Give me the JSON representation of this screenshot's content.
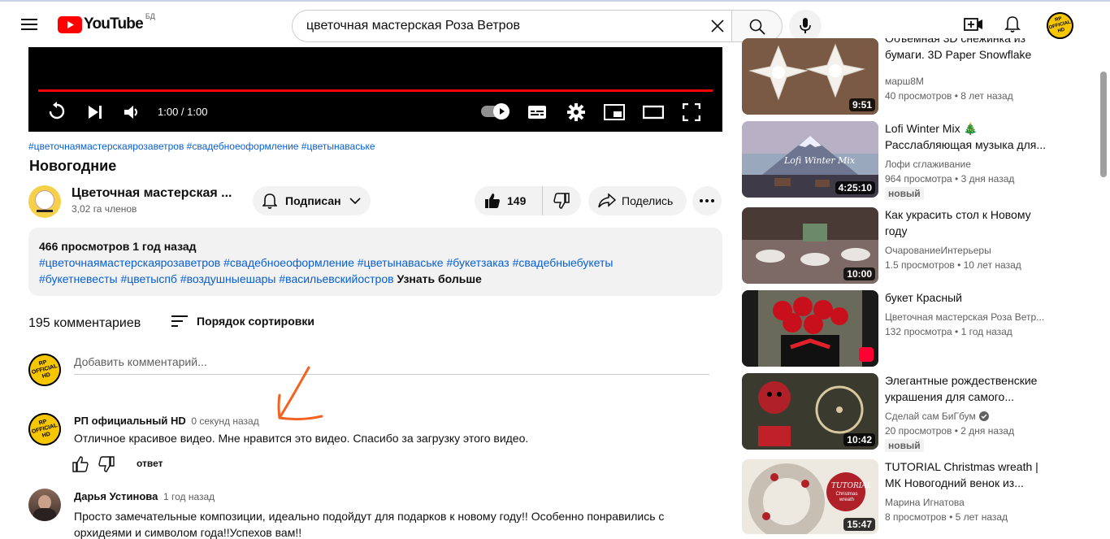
{
  "header": {
    "logo_text": "YouTube",
    "region": "БД",
    "search_value": "цветочная мастерская Роза Ветров",
    "avatar_text": "RP OFFICIAL HD"
  },
  "player": {
    "time": "1:00 / 1:00",
    "progress_percent": 100
  },
  "video": {
    "hashtags": "#цветочнаямастерскаярозаветров #свадебноеоформление #цветынаваське",
    "title": "Новогодние",
    "channel_name": "Цветочная мастерская ...",
    "channel_subs": "3,02 га членов",
    "subscribe_label": "Подписан",
    "likes": "149",
    "share_label": "Поделись"
  },
  "description": {
    "stats": "466 просмотров  1 год назад",
    "tags_line1": "#цветочнаямастерскаярозаветров #свадебноеоформление #цветынаваське #букетзаказ #свадебныебукеты",
    "tags_line2": "#букетневесты #цветыспб #воздушныешары #васильевскийостров",
    "more": "Узнать больше"
  },
  "comments": {
    "count": "195 комментариев",
    "sort_label": "Порядок сортировки",
    "add_placeholder": "Добавить комментарий...",
    "items": [
      {
        "author": "РП официальный HD",
        "time": "0 секунд назад",
        "text": "Отличное красивое видео. Мне нравится это видео. Спасибо за загрузку этого видео.",
        "reply": "ответ"
      },
      {
        "author": "Дарья Устинова",
        "time": "1 год назад",
        "text_line1": "Просто замечательные композиции, идеально подойдут для подарков к новому году!! Особенно понравились с",
        "text_line2": "орхидеями и символом года!!Успехов вам!!"
      }
    ]
  },
  "related": [
    {
      "title_line1": "Объемная 3D снежинка из",
      "title_line2": "бумаги. 3D Paper Snowflake",
      "channel": "марш8М",
      "meta": "40 просмотров • 8 лет назад",
      "duration": "9:51"
    },
    {
      "title_line1": "Lofi Winter Mix 🎄",
      "title_line2": "Расслабляющая музыка для...",
      "channel": "Лофи сглаживание",
      "meta": "964 просмотра • 3 дня назад",
      "duration": "4:25:10",
      "badge": "новый",
      "thumb_text": "Lofi Winter Mix"
    },
    {
      "title_line1": "Как украсить стол к Новому",
      "title_line2": "году",
      "channel": "ОчарованиеИнтерьеры",
      "meta": "1.5 просмотров • 10 лет назад",
      "duration": "10:00"
    },
    {
      "title_line1": "букет Красный",
      "channel": "Цветочная мастерская Роза Ветр...",
      "meta": "132 просмотра • 1 год назад"
    },
    {
      "title_line1": "Элегантные рождественские",
      "title_line2": "украшения для самого...",
      "channel": "Сделай сам БиГбум",
      "meta": "20 просмотров • 2 дня назад",
      "duration": "10:42",
      "badge": "новый"
    },
    {
      "title_line1": "TUTORIAL Christmas wreath |",
      "title_line2": "МК Новогодний венок из...",
      "channel": "Марина Игнатова",
      "meta": "8 просмотров • 5 лет назад",
      "duration": "15:47",
      "thumb_text_1": "TUTORIAL",
      "thumb_text_2": "Christmas wreath"
    }
  ],
  "colors": {
    "accent": "#ff0000",
    "link": "#065fd4",
    "annotation_arrow": "#f26322"
  }
}
